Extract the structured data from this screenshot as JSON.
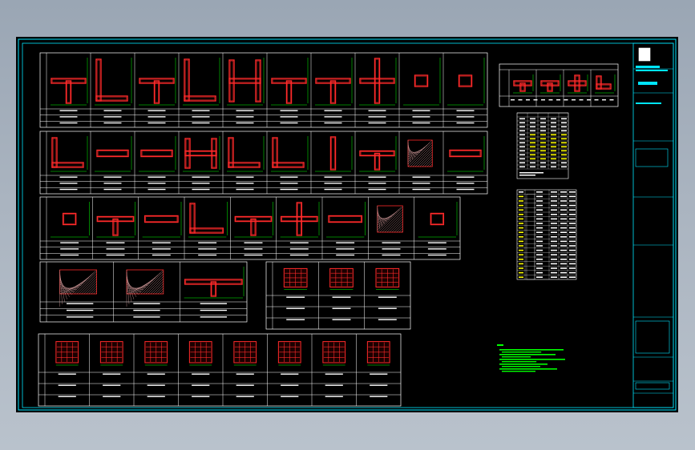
{
  "drawing": {
    "sheet_title": "",
    "notes_label": "",
    "notes_lines": 5
  },
  "colors": {
    "background": "#000000",
    "frame": "#00e5ff",
    "table_lines": "#ffffff",
    "rebar": "#ff2a2a",
    "dimension": "#00ff00",
    "notes": "#00ff00",
    "highlight_cells": "#ffff00",
    "window_bg": "#a9b3be"
  },
  "schedule_rows": {
    "row1_count": 10,
    "row2_count": 10,
    "row3_count": 9,
    "row4_count": 3,
    "square_section_count": 3,
    "bottom_count": 8
  },
  "right_tables": {
    "section_table_cols": 4,
    "small_table_rows": 14,
    "large_table_rows": 20
  },
  "title_block": {
    "logo_icon": "title-block-logo"
  }
}
